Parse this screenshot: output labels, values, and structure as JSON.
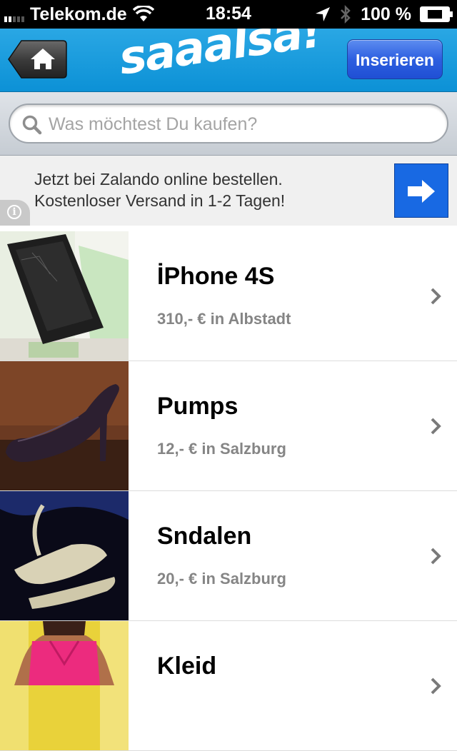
{
  "status_bar": {
    "carrier": "Telekom.de",
    "time": "18:54",
    "battery": "100 %"
  },
  "nav": {
    "logo_text": "saaalsa!",
    "insert_label": "Inserieren"
  },
  "search": {
    "placeholder": "Was möchtest Du kaufen?"
  },
  "ad": {
    "line1": "Jetzt bei Zalando online bestellen.",
    "line2": "Kostenloser Versand in 1-2 Tagen!"
  },
  "listings": [
    {
      "title": "İPhone 4S",
      "subtitle": "310,- € in Albstadt"
    },
    {
      "title": "Pumps",
      "subtitle": "12,- € in Salzburg"
    },
    {
      "title": "Sndalen",
      "subtitle": "20,- € in Salzburg"
    },
    {
      "title": "Kleid",
      "subtitle": ""
    }
  ],
  "colors": {
    "nav_blue": "#1a9ad9",
    "button_blue": "#2d5fe0",
    "ad_arrow_blue": "#1869e3"
  }
}
